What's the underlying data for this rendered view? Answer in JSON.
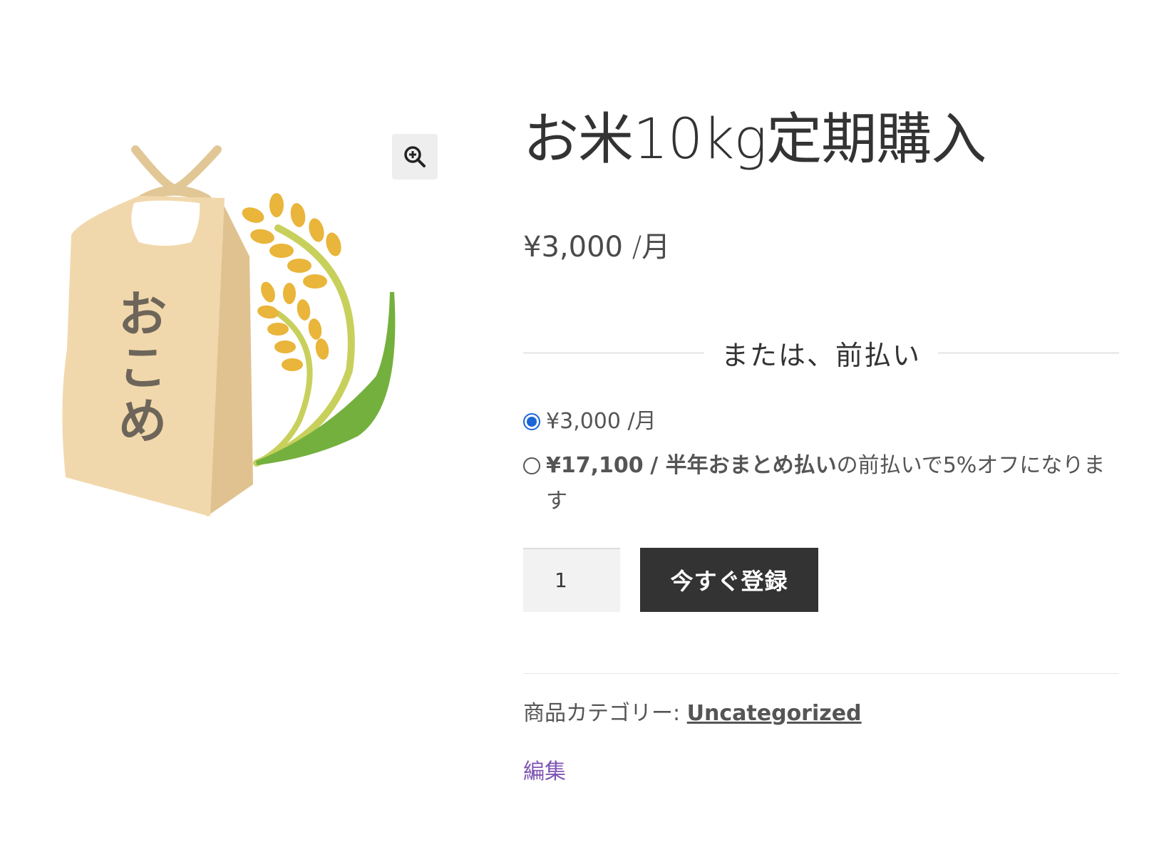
{
  "gallery": {
    "zoom_icon": "magnifier-plus-icon",
    "bag_label": [
      "お",
      "こ",
      "め"
    ]
  },
  "product": {
    "title": "お米10kg定期購入",
    "price": "¥3,000",
    "price_period": "/月"
  },
  "purchase_options": {
    "divider_text": "または、前払い",
    "options": [
      {
        "checked": true,
        "price": "¥3,000",
        "period": "/月",
        "bold_period": false,
        "suffix": ""
      },
      {
        "checked": false,
        "price": "¥17,100",
        "period": "/ 半年おまとめ払い",
        "bold_period": true,
        "suffix": "の前払いで5%オフになります"
      }
    ]
  },
  "cart": {
    "quantity": "1",
    "add_button_label": "今すぐ登録"
  },
  "meta": {
    "category_label": "商品カテゴリー:",
    "category_link": "Uncategorized",
    "edit_link": "編集"
  },
  "colors": {
    "accent_radio": "#1a66d6",
    "button_bg": "#333333",
    "edit_link": "#7f54b3"
  }
}
